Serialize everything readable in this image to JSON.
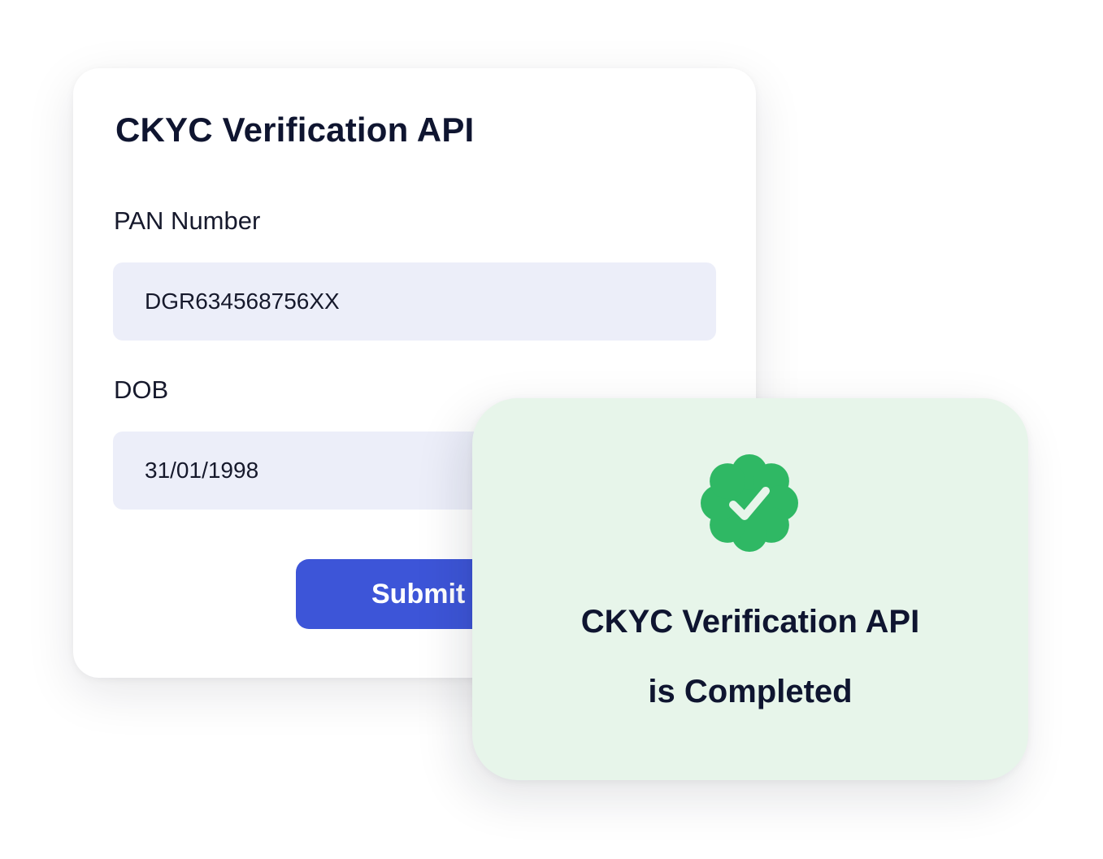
{
  "form": {
    "title": "CKYC Verification API",
    "pan_label": "PAN Number",
    "pan_value": "DGR634568756XX",
    "dob_label": "DOB",
    "dob_value": "31/01/1998",
    "submit_label": "Submit"
  },
  "success": {
    "icon": "check-badge-icon",
    "line1": "CKYC Verification API",
    "line2": "is Completed"
  },
  "colors": {
    "primary": "#3d55d8",
    "success_bg": "#e7f5ea",
    "success_icon": "#2fb864",
    "input_bg": "#eceef9",
    "text": "#0f1530"
  }
}
